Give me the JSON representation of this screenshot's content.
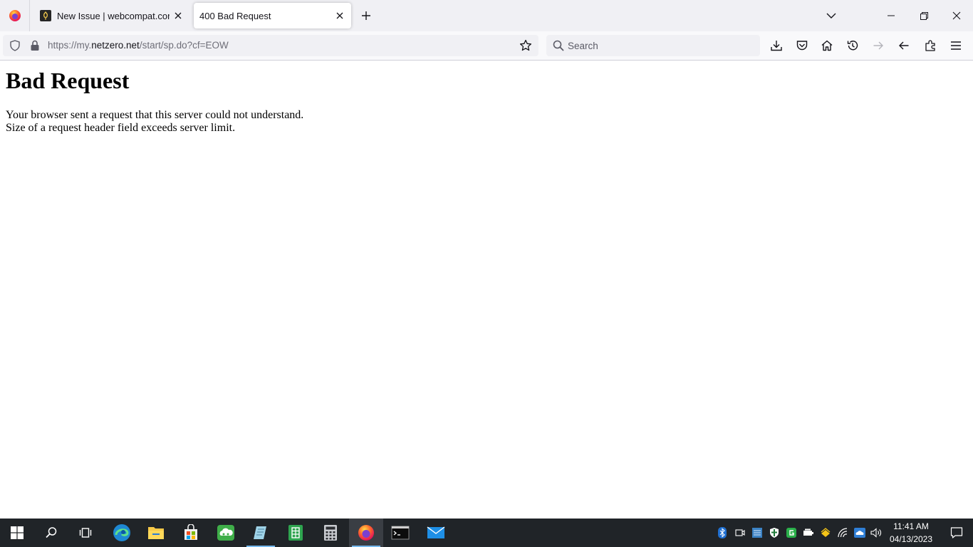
{
  "tabs": [
    {
      "label": "New Issue | webcompat.com",
      "icon": "webcompat-favicon"
    },
    {
      "label": "400 Bad Request",
      "icon": "none"
    }
  ],
  "navbar": {
    "url_prefix": "https://my.",
    "url_host": "netzero.net",
    "url_path": "/start/sp.do?cf=EOW",
    "search_placeholder": "Search"
  },
  "page": {
    "heading": "Bad Request",
    "line1": "Your browser sent a request that this server could not understand.",
    "line2": "Size of a request header field exceeds server limit."
  },
  "taskbar": {
    "time": "11:41 AM",
    "date": "04/13/2023",
    "apps": [
      "start-icon",
      "search-icon",
      "task-view-icon",
      "edge-icon",
      "file-explorer-icon",
      "store-icon",
      "cloud-app-icon",
      "notepad-icon",
      "spreadsheet-icon",
      "calculator-icon",
      "firefox-icon",
      "terminal-icon",
      "mail-icon"
    ]
  },
  "colors": {
    "tabstrip_bg": "#f0f0f4",
    "navbar_bg": "#f9f9fb",
    "taskbar_bg": "#202428",
    "taskbar_active_indicator": "#76b9ed"
  }
}
